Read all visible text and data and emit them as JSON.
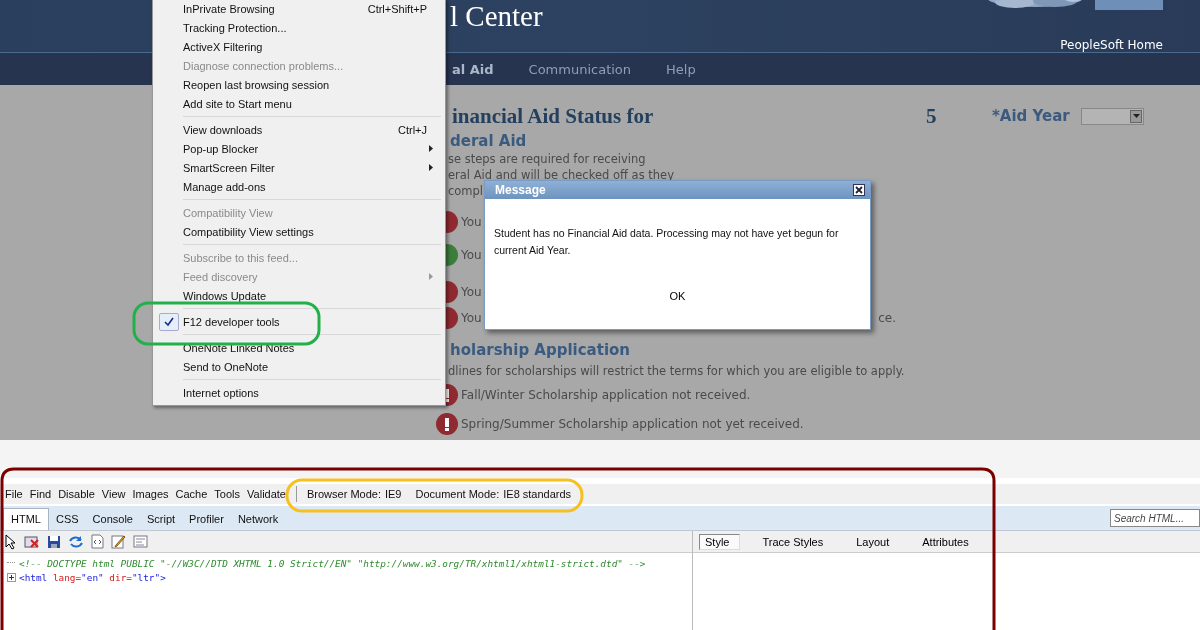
{
  "page": {
    "title": "l Center",
    "home_link": "PeopleSoft Home",
    "nav": [
      {
        "label": "al Aid",
        "selected": true
      },
      {
        "label": "Communication",
        "selected": false
      },
      {
        "label": "Help",
        "selected": false
      }
    ],
    "heading": "inancial Aid Status for",
    "heading_tail": "5",
    "aid_year_label": "*Aid Year",
    "section_1": {
      "title": "deral Aid",
      "lines": [
        "se steps are required for receiving",
        "eral Aid and will be checked off as they",
        "compl"
      ]
    },
    "status_rows": [
      {
        "kind": "error",
        "text": "You"
      },
      {
        "kind": "ok",
        "text": "You"
      },
      {
        "kind": "error",
        "text": "You"
      },
      {
        "kind": "error",
        "text": "You",
        "tail": "ce."
      }
    ],
    "section_2": {
      "title": "holarship Application",
      "intro": "dlines for scholarships will restrict the terms for which you are eligible to apply.",
      "items": [
        {
          "kind": "error",
          "text": "Fall/Winter Scholarship application not received."
        },
        {
          "kind": "error",
          "text": "Spring/Summer Scholarship application not yet received."
        }
      ]
    }
  },
  "menu": [
    [
      {
        "label": "InPrivate Browsing",
        "shortcut": "Ctrl+Shift+P",
        "disabled": false,
        "submenu": false,
        "checked": false
      },
      {
        "label": "Tracking Protection...",
        "disabled": false,
        "submenu": false,
        "checked": false
      },
      {
        "label": "ActiveX Filtering",
        "disabled": false,
        "submenu": false,
        "checked": false
      },
      {
        "label": "Diagnose connection problems...",
        "disabled": true,
        "submenu": false,
        "checked": false
      },
      {
        "label": "Reopen last browsing session",
        "disabled": false,
        "submenu": false,
        "checked": false
      },
      {
        "label": "Add site to Start menu",
        "disabled": false,
        "submenu": false,
        "checked": false
      }
    ],
    [
      {
        "label": "View downloads",
        "shortcut": "Ctrl+J",
        "disabled": false,
        "submenu": false,
        "checked": false
      },
      {
        "label": "Pop-up Blocker",
        "disabled": false,
        "submenu": true,
        "checked": false
      },
      {
        "label": "SmartScreen Filter",
        "disabled": false,
        "submenu": true,
        "checked": false
      },
      {
        "label": "Manage add-ons",
        "disabled": false,
        "submenu": false,
        "checked": false
      }
    ],
    [
      {
        "label": "Compatibility View",
        "disabled": true,
        "submenu": false,
        "checked": false
      },
      {
        "label": "Compatibility View settings",
        "disabled": false,
        "submenu": false,
        "checked": false
      }
    ],
    [
      {
        "label": "Subscribe to this feed...",
        "disabled": true,
        "submenu": false,
        "checked": false
      },
      {
        "label": "Feed discovery",
        "disabled": true,
        "submenu": true,
        "checked": false
      },
      {
        "label": "Windows Update",
        "disabled": false,
        "submenu": false,
        "checked": false
      }
    ],
    [
      {
        "label": "F12 developer tools",
        "disabled": false,
        "submenu": false,
        "checked": true
      }
    ],
    [
      {
        "label": "OneNote Linked Notes",
        "disabled": false,
        "submenu": false,
        "checked": false
      },
      {
        "label": "Send to OneNote",
        "disabled": false,
        "submenu": false,
        "checked": false
      }
    ],
    [
      {
        "label": "Internet options",
        "disabled": false,
        "submenu": false,
        "checked": false
      }
    ]
  ],
  "dialog": {
    "title": "Message",
    "text": "Student has no Financial Aid data. Processing may not have yet begun for current Aid Year.",
    "button": "OK"
  },
  "devtools": {
    "menubar": [
      "File",
      "Find",
      "Disable",
      "View",
      "Images",
      "Cache",
      "Tools",
      "Validate"
    ],
    "modes": [
      {
        "label": "Browser Mode:",
        "value": "IE9"
      },
      {
        "label": "Document Mode:",
        "value": "IE8 standards"
      }
    ],
    "tabs": [
      {
        "label": "HTML",
        "selected": true
      },
      {
        "label": "CSS",
        "selected": false
      },
      {
        "label": "Console",
        "selected": false
      },
      {
        "label": "Script",
        "selected": false
      },
      {
        "label": "Profiler",
        "selected": false
      },
      {
        "label": "Network",
        "selected": false
      }
    ],
    "search": {
      "placeholder": "Search HTML..."
    },
    "side_tabs": [
      {
        "label": "Style",
        "selected": true
      },
      {
        "label": "Trace Styles",
        "selected": false
      },
      {
        "label": "Layout",
        "selected": false
      },
      {
        "label": "Attributes",
        "selected": false
      }
    ],
    "code": [
      {
        "expandable": false,
        "segments": [
          {
            "kind": "comment",
            "text": "<!-- DOCTYPE html PUBLIC \"-//W3C//DTD XHTML 1.0 Strict//EN\" \"http://www.w3.org/TR/xhtml1/xhtml1-strict.dtd\" -->"
          }
        ]
      },
      {
        "expandable": true,
        "segments": [
          {
            "kind": "tag",
            "text": "<html"
          },
          {
            "kind": "attr",
            "text": " lang"
          },
          {
            "kind": "value",
            "text": "=\"en\""
          },
          {
            "kind": "attr",
            "text": " dir"
          },
          {
            "kind": "value",
            "text": "=\"ltr\""
          },
          {
            "kind": "tag",
            "text": ">"
          }
        ]
      }
    ]
  }
}
